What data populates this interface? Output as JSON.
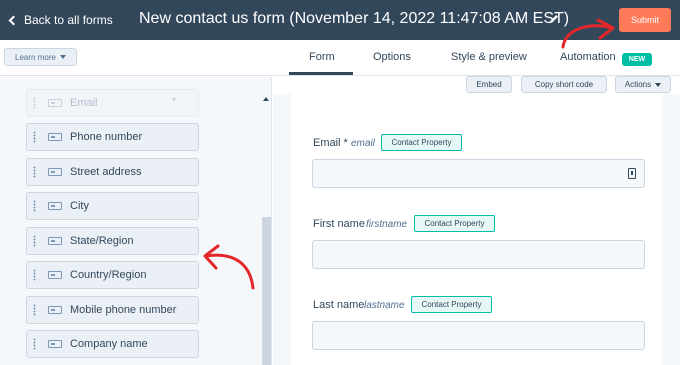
{
  "header": {
    "back_label": "Back to all forms",
    "title": "New contact us form (November 14, 2022 11:47:08 AM EST)",
    "submit_label": "Submit"
  },
  "tabs_bar": {
    "learn_more_label": "Learn more",
    "tabs": [
      {
        "label": "Form",
        "active": true
      },
      {
        "label": "Options",
        "active": false
      },
      {
        "label": "Style & preview",
        "active": false
      },
      {
        "label": "Automation",
        "active": false
      }
    ],
    "new_badge": "NEW"
  },
  "action_bar": {
    "embed_label": "Embed",
    "copy_label": "Copy short code",
    "actions_label": "Actions"
  },
  "field_list": {
    "items": [
      {
        "label": "Email",
        "star": "*"
      },
      {
        "label": "Phone number"
      },
      {
        "label": "Street address"
      },
      {
        "label": "City"
      },
      {
        "label": "State/Region"
      },
      {
        "label": "Country/Region"
      },
      {
        "label": "Mobile phone number"
      },
      {
        "label": "Company name"
      }
    ]
  },
  "form_preview": {
    "fields": [
      {
        "label": "Email *",
        "internal": "email",
        "badge": "Contact Property"
      },
      {
        "label": "First name",
        "internal": "firstname",
        "badge": "Contact Property"
      },
      {
        "label": "Last name",
        "internal": "lastname",
        "badge": "Contact Property"
      }
    ]
  },
  "colors": {
    "header_bg": "#33475b",
    "submit_bg": "#ff7a59",
    "accent_teal": "#00bda5",
    "annotation_red": "#e3262a"
  },
  "icons": [
    "chevron-left-icon",
    "pencil-icon",
    "caret-down-icon",
    "drag-handle-icon",
    "text-field-icon",
    "contact-card-icon",
    "arrow-annotation-icon"
  ]
}
